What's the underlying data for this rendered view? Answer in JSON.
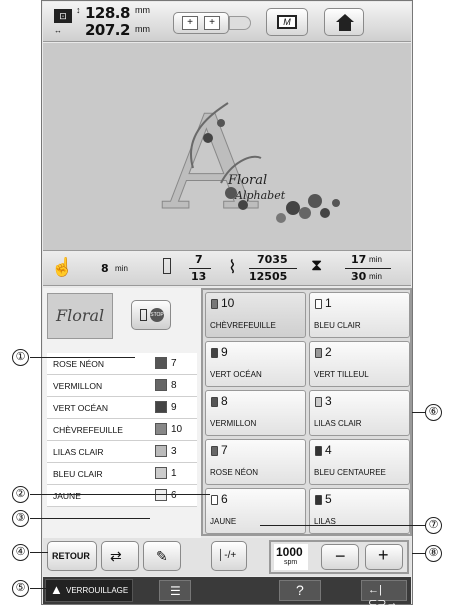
{
  "header": {
    "width_value": "128.8",
    "height_value": "207.2",
    "unit": "mm"
  },
  "preview": {
    "letter": "A",
    "caption_line1": "Floral",
    "caption_line2": "Alphabet"
  },
  "status": {
    "time_left": "8",
    "time_unit": "min",
    "stitch_cur": "7",
    "stitch_tot": "13",
    "count_cur": "7035",
    "count_tot": "12505",
    "t1": "17",
    "t2": "30",
    "t_unit": "min"
  },
  "left_panel": {
    "pattern_name": "Floral",
    "colors": [
      {
        "name": "ROSE NÉON",
        "num": "7",
        "color": "#555"
      },
      {
        "name": "VERMILLON",
        "num": "8",
        "color": "#666"
      },
      {
        "name": "VERT OCÉAN",
        "num": "9",
        "color": "#444"
      },
      {
        "name": "CHÈVREFEUILLE",
        "num": "10",
        "color": "#888"
      },
      {
        "name": "LILAS CLAIR",
        "num": "3",
        "color": "#bbb"
      },
      {
        "name": "BLEU CLAIR",
        "num": "1",
        "color": "#ccc"
      },
      {
        "name": "JAUNE",
        "num": "6",
        "color": "#eee"
      }
    ]
  },
  "grid": [
    {
      "n": "10",
      "name": "CHÈVREFEUILLE",
      "color": "#777"
    },
    {
      "n": "1",
      "name": "BLEU CLAIR",
      "color": "#fff"
    },
    {
      "n": "9",
      "name": "VERT OCÉAN",
      "color": "#444"
    },
    {
      "n": "2",
      "name": "VERT TILLEUL",
      "color": "#999"
    },
    {
      "n": "8",
      "name": "VERMILLON",
      "color": "#555"
    },
    {
      "n": "3",
      "name": "LILAS CLAIR",
      "color": "#ccc"
    },
    {
      "n": "7",
      "name": "ROSE NÉON",
      "color": "#666"
    },
    {
      "n": "4",
      "name": "BLEU CENTAUREE",
      "color": "#333"
    },
    {
      "n": "6",
      "name": "JAUNE",
      "color": "#fff"
    },
    {
      "n": "5",
      "name": "LILAS",
      "color": "#333"
    }
  ],
  "bottom": {
    "retour": "RETOUR",
    "speed": "1000",
    "speed_unit": "spm",
    "minus": "−",
    "plus": "+",
    "verrouillage": "VERROUILLAGE"
  },
  "callouts": [
    "①",
    "②",
    "③",
    "④",
    "⑤",
    "⑥",
    "⑦",
    "⑧"
  ]
}
